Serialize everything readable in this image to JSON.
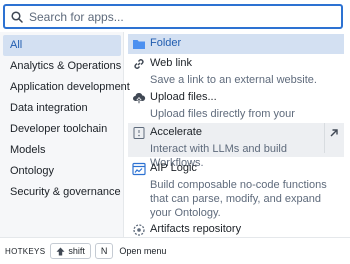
{
  "search": {
    "placeholder": "Search for apps..."
  },
  "sidebar": {
    "items": [
      {
        "label": "All",
        "active": true
      },
      {
        "label": "Analytics & Operations"
      },
      {
        "label": "Application development"
      },
      {
        "label": "Data integration"
      },
      {
        "label": "Developer toolchain"
      },
      {
        "label": "Models"
      },
      {
        "label": "Ontology"
      },
      {
        "label": "Security & governance"
      }
    ]
  },
  "apps": [
    {
      "title": "Folder",
      "description": "",
      "icon": "folder-icon"
    },
    {
      "title": "Web link",
      "description": "Save a link to an external website.",
      "icon": "link-icon"
    },
    {
      "title": "Upload files...",
      "description": "Upload files directly from your computer.",
      "icon": "cloud-upload-icon"
    },
    {
      "title": "Accelerate",
      "description": "Interact with LLMs and build Workflows.",
      "icon": "accelerate-icon"
    },
    {
      "title": "AIP Logic",
      "description": "Build composable no-code functions that can parse, modify, and expand your Ontology.",
      "icon": "logic-icon"
    },
    {
      "title": "Artifacts repository",
      "description": "",
      "icon": "artifacts-icon"
    }
  ],
  "footer": {
    "hotkeys_label": "HOTKEYS",
    "shift_key": "shift",
    "n_key": "N",
    "action": "Open menu"
  },
  "colors": {
    "accent": "#2d72d2",
    "active_bg": "#d3e0f2",
    "active_text": "#215db0"
  }
}
